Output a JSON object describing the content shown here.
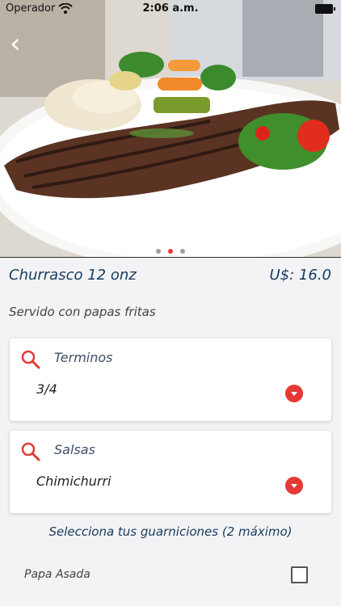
{
  "status_bar": {
    "carrier": "Operador",
    "time": "2:06 a.m."
  },
  "hero": {
    "image": "steak-plate-photo",
    "carousel_dots": [
      false,
      true,
      false
    ]
  },
  "product": {
    "name": "Churrasco 12 onz",
    "price": "U$: 16.0",
    "description": "Servido con papas fritas"
  },
  "options": [
    {
      "label": "Terminos",
      "value": "3/4"
    },
    {
      "label": "Salsas",
      "value": "Chimichurri"
    }
  ],
  "sides": {
    "heading": "Selecciona tus guarniciones (2 máximo)",
    "items": [
      {
        "label": "Papa Asada",
        "checked": false
      }
    ]
  },
  "colors": {
    "accent": "#e53935",
    "title": "#173a5e"
  }
}
